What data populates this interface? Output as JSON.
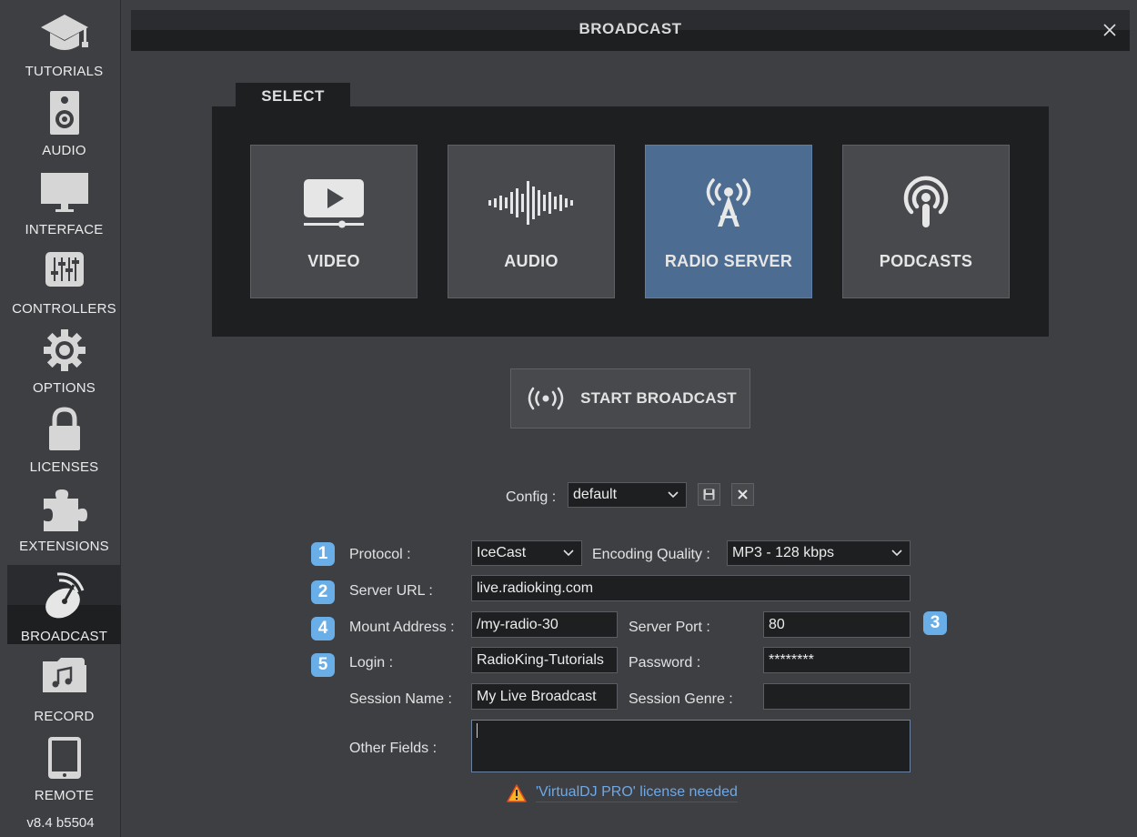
{
  "sidebar": {
    "items": [
      {
        "label": "TUTORIALS",
        "icon": "graduation-cap-icon"
      },
      {
        "label": "AUDIO",
        "icon": "speaker-icon"
      },
      {
        "label": "INTERFACE",
        "icon": "monitor-icon"
      },
      {
        "label": "CONTROLLERS",
        "icon": "mixer-sliders-icon"
      },
      {
        "label": "OPTIONS",
        "icon": "gear-icon"
      },
      {
        "label": "LICENSES",
        "icon": "lock-icon"
      },
      {
        "label": "EXTENSIONS",
        "icon": "puzzle-icon"
      },
      {
        "label": "BROADCAST",
        "icon": "satellite-dish-icon",
        "active": true
      },
      {
        "label": "RECORD",
        "icon": "music-folder-icon"
      },
      {
        "label": "REMOTE",
        "icon": "tablet-icon"
      }
    ],
    "version": "v8.4 b5504"
  },
  "window": {
    "title": "BROADCAST"
  },
  "select": {
    "tab_label": "SELECT",
    "modes": [
      {
        "label": "VIDEO",
        "icon": "video-play-icon"
      },
      {
        "label": "AUDIO",
        "icon": "waveform-icon"
      },
      {
        "label": "RADIO SERVER",
        "icon": "radio-tower-icon",
        "active": true
      },
      {
        "label": "PODCASTS",
        "icon": "podcast-icon"
      }
    ]
  },
  "start_broadcast": {
    "label": "START BROADCAST",
    "icon": "broadcast-waves-icon"
  },
  "config": {
    "label": "Config :",
    "value": "default"
  },
  "form": {
    "badges": [
      "1",
      "2",
      "3",
      "4",
      "5"
    ],
    "protocol_label": "Protocol :",
    "protocol_value": "IceCast",
    "encoding_label": "Encoding Quality :",
    "encoding_value": "MP3 - 128 kbps",
    "server_url_label": "Server URL :",
    "server_url_value": "live.radioking.com",
    "mount_label": "Mount Address :",
    "mount_value": "/my-radio-30",
    "port_label": "Server Port :",
    "port_value": "80",
    "login_label": "Login :",
    "login_value": "RadioKing-Tutorials",
    "password_label": "Password :",
    "password_value": "********",
    "session_name_label": "Session Name :",
    "session_name_value": "My Live Broadcast",
    "session_genre_label": "Session Genre :",
    "session_genre_value": "",
    "other_fields_label": "Other Fields :",
    "other_fields_value": ""
  },
  "warning": {
    "text": "'VirtualDJ PRO' license needed",
    "icon": "warning-triangle-icon"
  },
  "colors": {
    "accent": "#4d6c91",
    "badge": "#6aaee8",
    "link": "#6ea8e6",
    "warning": "#f5b323"
  }
}
